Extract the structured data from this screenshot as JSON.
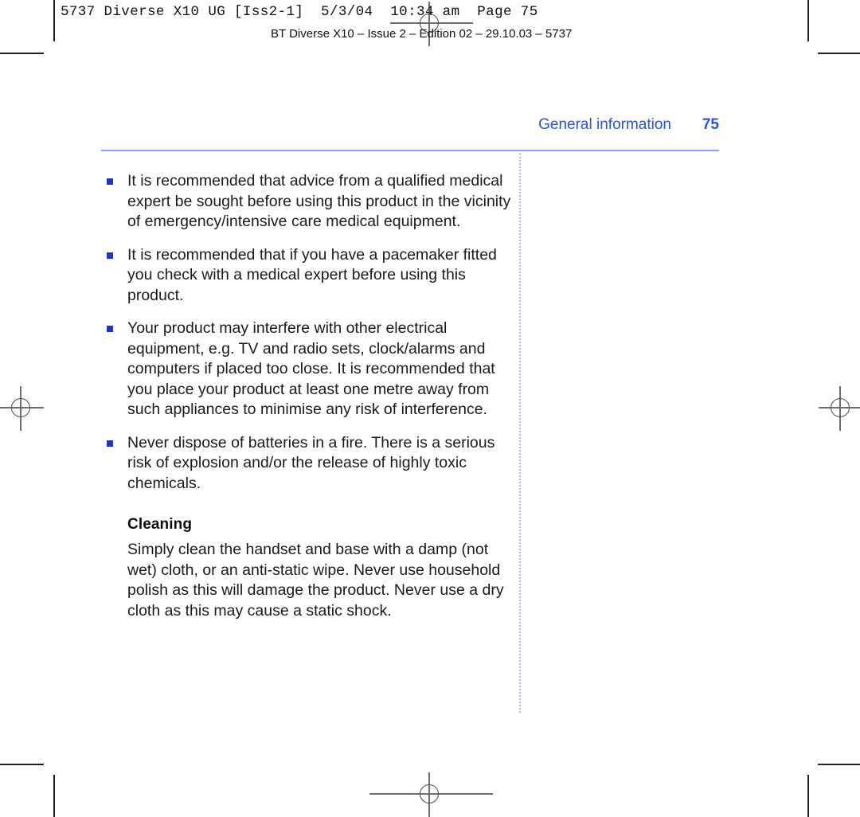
{
  "prepress": {
    "slug_line_1": "5737 Diverse X10 UG [Iss2-1]  5/3/04  10:34 am  Page 75",
    "slug_line_2": "BT Diverse X10 – Issue 2 – Edition 02 – 29.10.03 – 5737",
    "registration_mark_name": "registration-mark",
    "crop_mark_name": "crop-mark"
  },
  "running_head": {
    "title": "General information",
    "page_number": "75",
    "color": "#2b50d8"
  },
  "rules": {
    "horizontal_color": "#8b9cf0",
    "vertical_dotted_color": "#a9b6f5"
  },
  "content": {
    "bullets": [
      "It is recommended that advice from a qualified medical expert be sought before using this product in the vicinity of emergency/intensive care medical equipment.",
      "It is recommended that if you have a pacemaker fitted you check with a medical expert before using this product.",
      "Your product may interfere with other electrical equipment, e.g. TV and radio sets, clock/alarms and computers if placed too close. It is recommended that you place your product at least one metre away from such appliances to minimise any risk of interference.",
      "Never dispose of batteries in a fire. There is a serious risk of explosion and/or the release of highly toxic chemicals."
    ],
    "bullet_marker_color": "#1a35d6",
    "section_heading": "Cleaning",
    "section_paragraph": "Simply clean the handset and base with a damp (not wet) cloth, or an anti-static wipe. Never use household polish as this will damage the product. Never use a dry cloth as this may cause a static shock."
  }
}
